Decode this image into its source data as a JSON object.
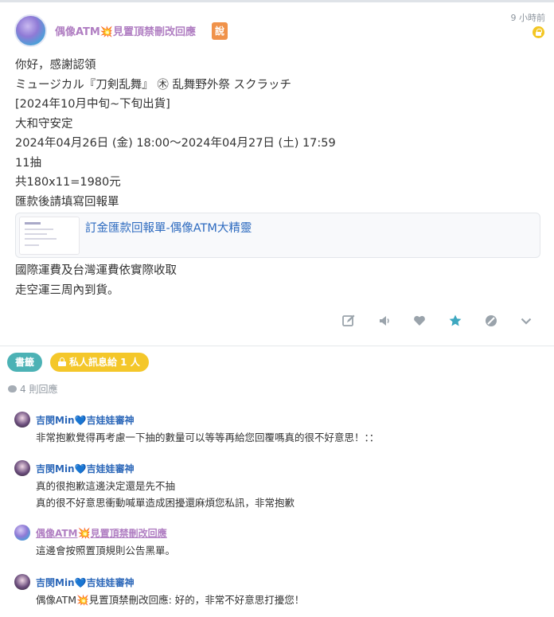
{
  "post": {
    "author": "偶像ATM",
    "author_suffix": "見置頂禁刪改回應",
    "badge": "說",
    "timestamp": "9 小時前",
    "lines_top": [
      "你好，感謝認領",
      "ミュージカル『刀剣乱舞』 ㊍ 乱舞野外祭 スクラッチ",
      "[2024年10月中旬~下旬出貨]",
      "大和守安定",
      "2024年04月26日 (金) 18:00～2024年04月27日 (土) 17:59",
      "11抽",
      "共180x11=1980元",
      "匯款後請填寫回報單"
    ],
    "link_title": "訂金匯款回報單-偶像ATM大精靈",
    "lines_bottom": [
      "國際運費及台灣運費依實際收取",
      "走空運三周內到貨。"
    ]
  },
  "actions": [
    {
      "name": "edit-icon",
      "color": "#9aa3ab"
    },
    {
      "name": "announce-icon",
      "color": "#9aa3ab"
    },
    {
      "name": "heart-icon",
      "color": "#9aa3ab"
    },
    {
      "name": "star-icon",
      "color": "#3ea8c0"
    },
    {
      "name": "block-icon",
      "color": "#9aa3ab"
    },
    {
      "name": "chevron-down-icon",
      "color": "#9aa3ab"
    }
  ],
  "tags": {
    "bookmark": "書籤",
    "private_message": "私人訊息給 1 人"
  },
  "reply_count": "4 則回應",
  "replies": [
    {
      "name": "吉閔Min",
      "heart": "💙",
      "name_suffix": "吉娃娃審神",
      "lines": [
        "非常抱歉覺得再考慮一下抽的數量可以等等再給您回覆嗎真的很不好意思！：："
      ]
    },
    {
      "name": "吉閔Min",
      "heart": "💙",
      "name_suffix": "吉娃娃審神",
      "lines": [
        "真的很抱歉這邊決定還是先不抽",
        "真的很不好意思衝動喊單造成困擾還麻煩您私訊，非常抱歉"
      ]
    },
    {
      "name": "偶像ATM",
      "heart": "",
      "name_suffix": "見置頂禁刪改回應",
      "lines": [
        "這邊會按照置頂規則公告黑單。"
      ]
    },
    {
      "name": "吉閔Min",
      "heart": "💙",
      "name_suffix": "吉娃娃審神",
      "lines": [
        "偶像ATM💥見置頂禁刪改回應: 好的，非常不好意思打擾您！"
      ]
    }
  ],
  "colors": {
    "author": "#b07ec2",
    "link": "#2f6cc0",
    "reply_name": "#2a66b8",
    "tag_bookmark": "#4cb2b5",
    "tag_pm": "#f4c72a",
    "badge": "#f0924a"
  }
}
